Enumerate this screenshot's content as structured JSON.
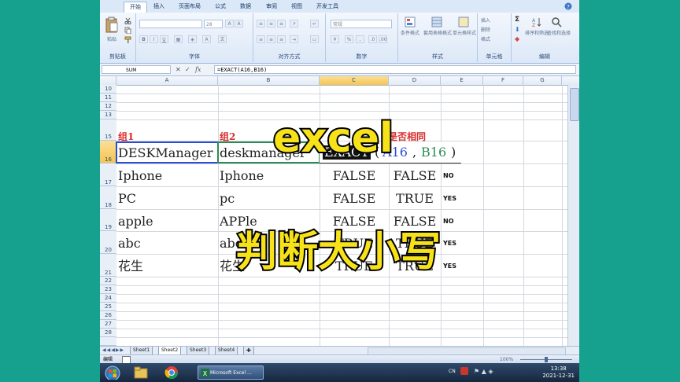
{
  "ribbon": {
    "tabs": [
      "开始",
      "插入",
      "页面布局",
      "公式",
      "数据",
      "审阅",
      "视图",
      "开发工具"
    ],
    "groups": [
      "剪贴板",
      "字体",
      "对齐方式",
      "数字",
      "样式",
      "单元格",
      "编辑"
    ],
    "paste_label": "粘贴",
    "font_size": "28",
    "number_format": "常规",
    "style_buttons": [
      "条件格式",
      "套用表格格式",
      "单元格样式"
    ],
    "cell_buttons": [
      "插入",
      "删除",
      "格式"
    ],
    "edit_buttons": [
      "排序和筛选",
      "查找和选择"
    ]
  },
  "formula_bar": {
    "name_box": "SUM",
    "formula": "=EXACT(A16,B16)"
  },
  "grid": {
    "columns": [
      "A",
      "B",
      "C",
      "D",
      "E",
      "F",
      "G"
    ],
    "rows": [
      "10",
      "11",
      "12",
      "13",
      "14",
      "15",
      "16",
      "17",
      "18",
      "19",
      "20",
      "21",
      "22",
      "23",
      "24",
      "25",
      "26",
      "27",
      "28"
    ],
    "headers": [
      "组1",
      "组2",
      "是否相同"
    ],
    "edit_prefix": "EXACT",
    "edit_ref_a": "A16",
    "edit_ref_b": "B16",
    "edit_paren_open": "(",
    "edit_comma": ",",
    "edit_paren_close": ")",
    "data": [
      {
        "a": "DESKManager",
        "b": "deskmanager"
      },
      {
        "a": "Iphone",
        "b": "Iphone",
        "c": "FALSE",
        "d": "FALSE",
        "e": "NO"
      },
      {
        "a": "PC",
        "b": "pc",
        "c": "FALSE",
        "d": "TRUE",
        "e": "YES"
      },
      {
        "a": "apple",
        "b": "APPle",
        "c": "FALSE",
        "d": "FALSE",
        "e": "NO"
      },
      {
        "a": "abc",
        "b": "abc",
        "c": "TRUE",
        "d": "TRUE",
        "e": "YES"
      },
      {
        "a": "花生",
        "b": "花生",
        "c": "TRUE",
        "d": "TRUE",
        "e": "YES"
      }
    ]
  },
  "sheets": [
    "Sheet1",
    "Sheet2",
    "Sheet3",
    "Sheet4"
  ],
  "status": {
    "mode": "编辑",
    "zoom": "100%"
  },
  "taskbar": {
    "excel_label": "Microsoft Excel ...",
    "lang": "CN",
    "time": "13:38",
    "date": "2021-12-31"
  },
  "overlay": {
    "title": "excel",
    "subtitle": "判断大小写"
  },
  "colors": {
    "background": "#16a08e",
    "overlay_text": "#f7e21a",
    "header_red": "#d82d2d",
    "ref_a": "#2a4cd6",
    "ref_b": "#2e8b57"
  }
}
